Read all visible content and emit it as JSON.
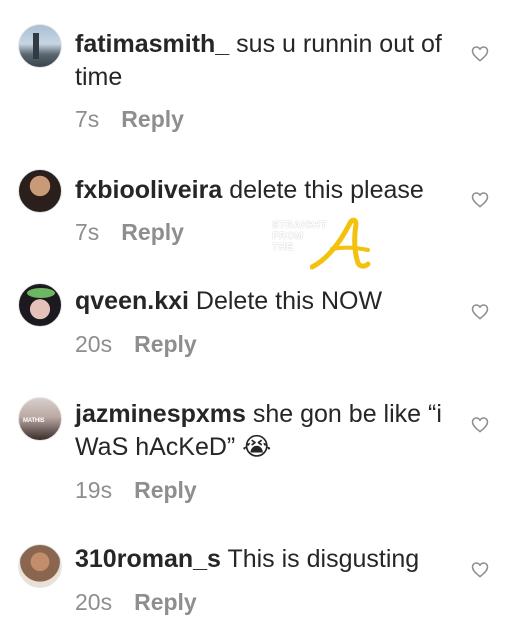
{
  "comments": [
    {
      "username": "fatimasmith_",
      "text": "sus u runnin out of time",
      "time": "7s",
      "reply": "Reply",
      "avatar": "city-skyline"
    },
    {
      "username": "fxbiooliveira",
      "text": "delete this please",
      "time": "7s",
      "reply": "Reply",
      "avatar": "man-portrait"
    },
    {
      "username": "qveen.kxi",
      "text": "Delete this NOW",
      "time": "20s",
      "reply": "Reply",
      "avatar": "woman-flower-crown"
    },
    {
      "username": "jazminespxms",
      "text": "she gon be like “i WaS hAcKeD” 😭",
      "time": "19s",
      "reply": "Reply",
      "avatar": "mathis-group"
    },
    {
      "username": "310roman_s",
      "text": "This is disgusting",
      "time": "20s",
      "reply": "Reply",
      "avatar": "person-portrait"
    }
  ],
  "avatar_tag": "MATHIS",
  "watermark": {
    "line1": "STRAIGHT",
    "line2": "FROM",
    "line3": "THE",
    "letter": "A",
    "color": "#f2c20f"
  },
  "icons": {
    "like": "heart-outline-icon"
  },
  "colors": {
    "text": "#262626",
    "meta": "#8e8e8e",
    "heart": "#8e8e8e"
  }
}
